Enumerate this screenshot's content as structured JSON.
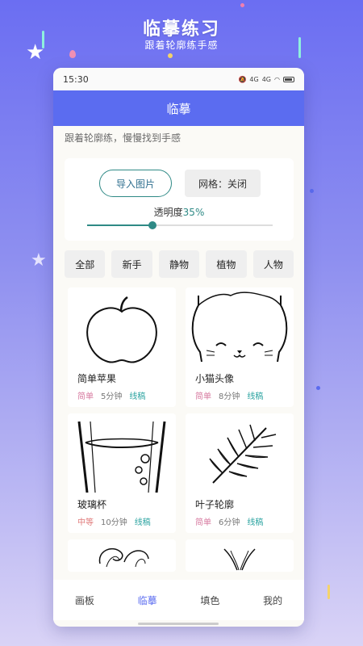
{
  "promo": {
    "title": "临摹练习",
    "subtitle": "跟着轮廓练手感"
  },
  "status": {
    "time": "15:30",
    "net1": "4G",
    "net2": "4G"
  },
  "app": {
    "title": "临摹",
    "subtitle": "跟着轮廓练，慢慢找到手感",
    "import_label": "导入图片",
    "grid_label": "网格：关闭",
    "opacity_label": "透明度",
    "opacity_value": "35%",
    "opacity_fraction": 0.35
  },
  "filters": [
    "全部",
    "新手",
    "静物",
    "植物",
    "人物"
  ],
  "items": [
    {
      "name": "简单苹果",
      "level": "简单",
      "duration": "5分钟",
      "type": "线稿",
      "icon": "apple-sketch"
    },
    {
      "name": "小猫头像",
      "level": "简单",
      "duration": "8分钟",
      "type": "线稿",
      "icon": "cat-sketch"
    },
    {
      "name": "玻璃杯",
      "level": "中等",
      "duration": "10分钟",
      "type": "线稿",
      "icon": "glass-sketch"
    },
    {
      "name": "叶子轮廓",
      "level": "简单",
      "duration": "6分钟",
      "type": "线稿",
      "icon": "leaf-sketch"
    }
  ],
  "tabs": [
    "画板",
    "临摹",
    "填色",
    "我的"
  ],
  "active_tab": 1,
  "colors": {
    "accent": "#5b6cf0",
    "teal": "#2f8a86",
    "easy": "#d77aa0",
    "medium": "#e07b7b"
  }
}
